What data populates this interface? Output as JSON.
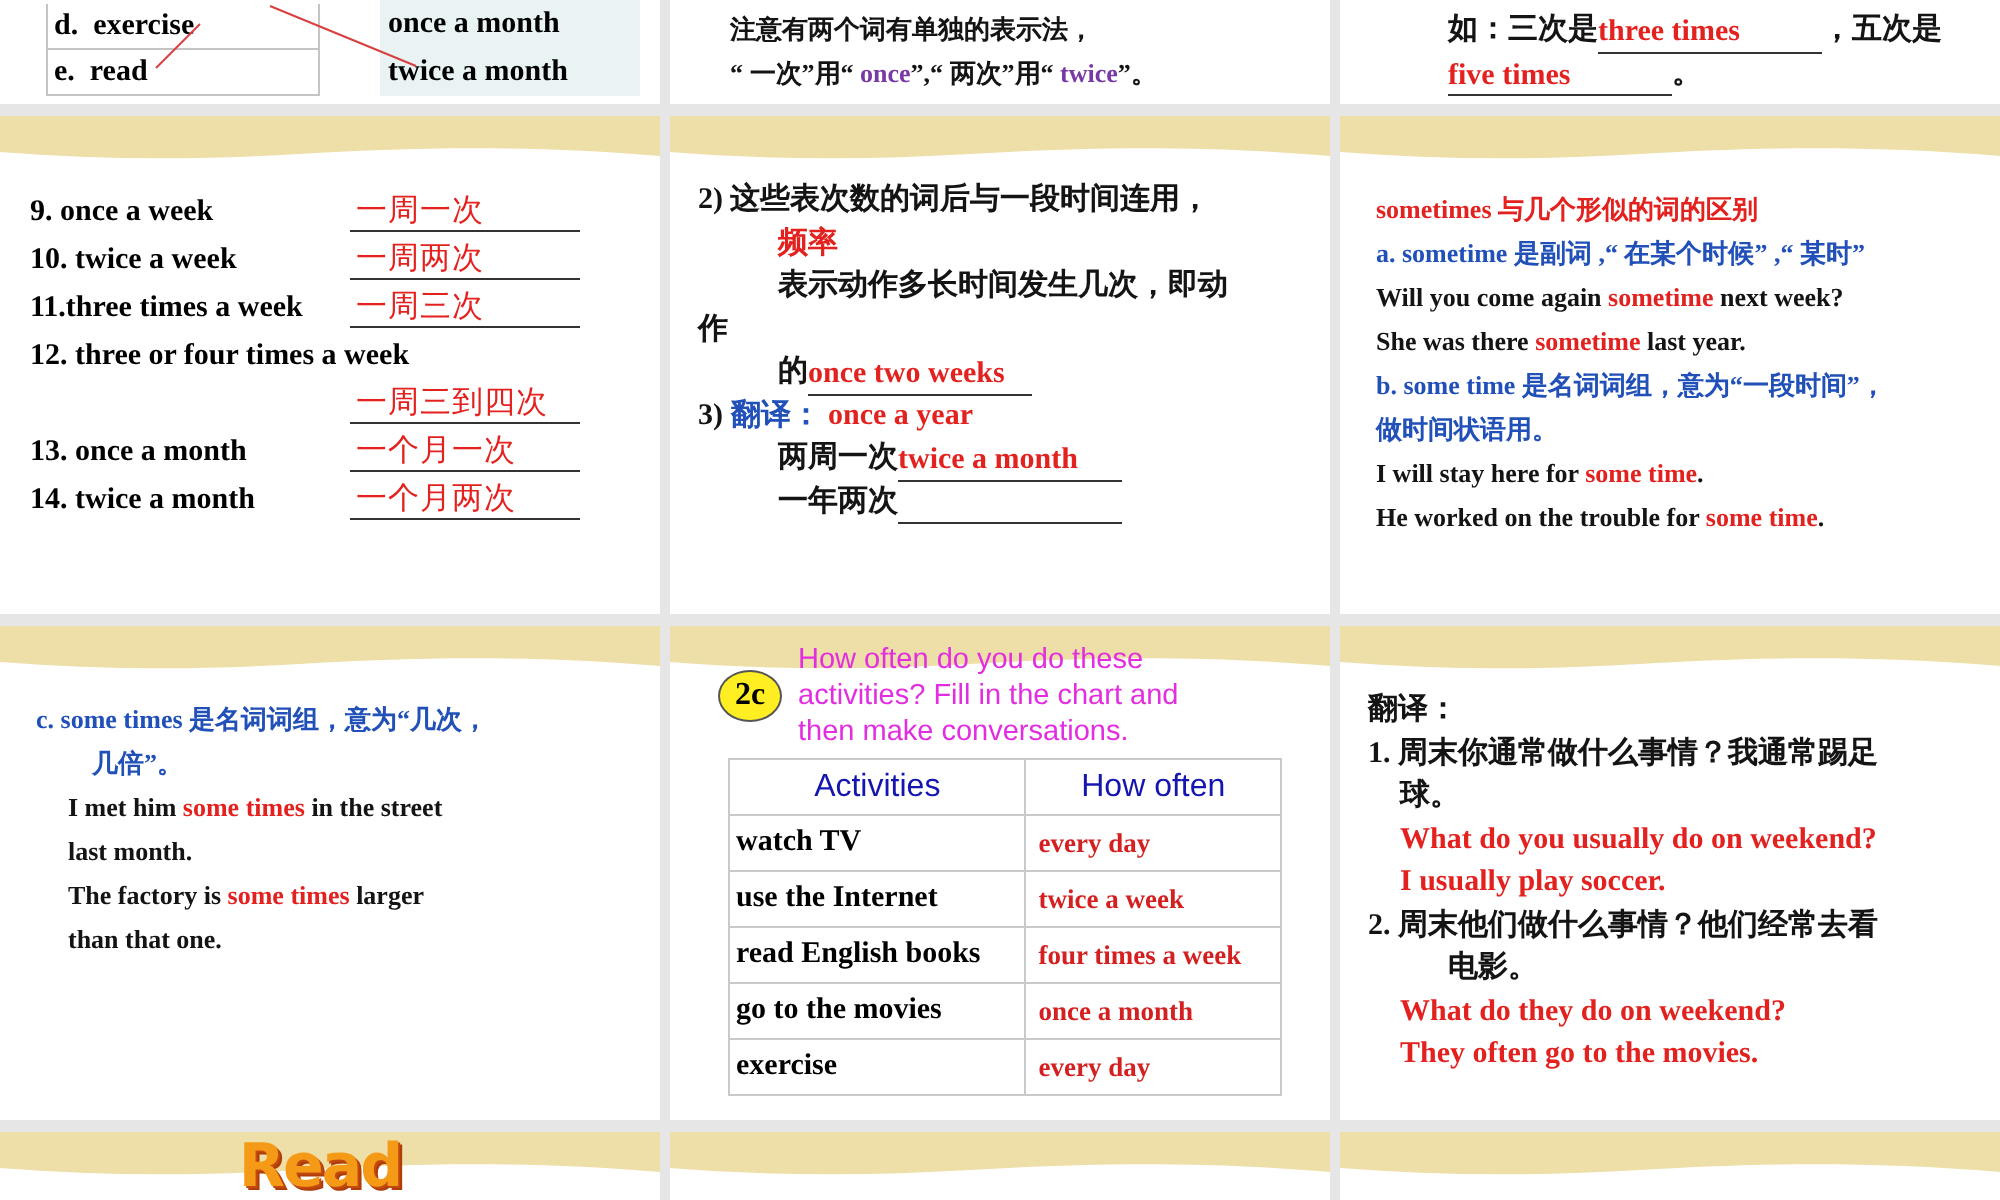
{
  "slides": [
    {
      "kind": "matching",
      "activities": [
        "d.  exercise",
        "e.  read"
      ],
      "options": [
        "once a month",
        "twice a month"
      ]
    },
    {
      "kind": "grammar",
      "lines": [
        {
          "kind": "note",
          "text": "注意有两个词有单独的表示法，"
        },
        {
          "kind": "note",
          "text": "“ 一次”用“ *once*”,“ 两次”用“ *twice*”。"
        }
      ]
    },
    {
      "kind": "exercise",
      "lines": [
        {
          "kind": "fill",
          "before": "如：三次是 ",
          "answer": "three times",
          "after": " ，五次是"
        },
        {
          "kind": "fill",
          "answer": "five times",
          "after": " 。"
        }
      ]
    },
    {
      "kind": "vocab",
      "items": [
        {
          "kind": "inline",
          "term": "9. once a week",
          "answer": "一周一次"
        },
        {
          "kind": "inline",
          "term": "10. twice a week",
          "answer": "一周两次"
        },
        {
          "kind": "inline",
          "term": "11.three times a week",
          "answer": "一周三次"
        },
        {
          "kind": "below",
          "term": "12. three or four times a week",
          "answer": "一周三到四次"
        },
        {
          "kind": "inline",
          "term": "13. once a month",
          "answer": "一个月一次"
        },
        {
          "kind": "inline",
          "term": "14. twice a month",
          "answer": "一个月两次"
        }
      ]
    },
    {
      "kind": "exercise",
      "lines": [
        {
          "kind": "plain",
          "text": "2)  这些表次数的词后与一段时间连用，"
        },
        {
          "kind": "mark",
          "text": "频率"
        },
        {
          "kind": "wrap",
          "text": "表示动作多长时间发生几次，即动"
        },
        {
          "kind": "plain",
          "text": "作"
        },
        {
          "kind": "fill",
          "before": "的 ",
          "answer": "once two weeks"
        },
        {
          "kind": "plain",
          "text": "3)  **翻译：**     *once a year*"
        },
        {
          "kind": "fill",
          "before": "两周一次  ",
          "answer": "twice a month"
        },
        {
          "kind": "fill",
          "before": "一年两次  "
        }
      ]
    },
    {
      "kind": "grammar",
      "lines": [
        {
          "kind": "heading",
          "text": "sometimes 与几个形似的词的区别"
        },
        {
          "kind": "topic",
          "text": "a. sometime 是副词 ,“ 在某个时候” ,“ 某时”"
        },
        {
          "kind": "plain",
          "text": "Will you come again *sometime* next week?"
        },
        {
          "kind": "plain",
          "text": " She was there *sometime* last year."
        },
        {
          "kind": "topic",
          "text": "b. some time 是名词词组，意为“一段时间”，"
        },
        {
          "kind": "topic",
          "text": "做时间状语用。"
        },
        {
          "kind": "plain",
          "text": "I will stay here for *some time*."
        },
        {
          "kind": "plain",
          "text": "He worked on the trouble for *some time*."
        }
      ]
    },
    {
      "kind": "grammar",
      "lines": [
        {
          "kind": "topic",
          "text": "c. some times 是名词词组，意为“几次，"
        },
        {
          "kind": "subtopic",
          "text": "几倍”。"
        },
        {
          "kind": "indent",
          "text": "I met him *some times* in the street"
        },
        {
          "kind": "indent",
          "text": "last month."
        },
        {
          "kind": "indent",
          "text": "The factory is *some times* larger"
        },
        {
          "kind": "indent",
          "text": "than that one."
        }
      ]
    },
    {
      "kind": "table",
      "badge": "2c",
      "prompt": "How often do you do these activities? Fill in the chart and then make conversations.",
      "columns": [
        "Activities",
        "How often"
      ],
      "rows": [
        [
          "watch TV",
          "every day"
        ],
        [
          "use the Internet",
          "twice a week"
        ],
        [
          "read English books",
          "four times a week"
        ],
        [
          "go to the movies",
          "once a month"
        ],
        [
          "exercise",
          "every day"
        ]
      ]
    },
    {
      "kind": "exercise",
      "lines": [
        {
          "kind": "plain",
          "text": "翻译："
        },
        {
          "kind": "plain",
          "text": "1.  周末你通常做什么事情？我通常踢足"
        },
        {
          "kind": "indent",
          "text": "球。"
        },
        {
          "kind": "answer",
          "text": "What do you usually do on weekend?"
        },
        {
          "kind": "answer",
          "text": " I usually play soccer."
        },
        {
          "kind": "plain",
          "text": "2.  周末他们做什么事情？他们经常去看"
        },
        {
          "kind": "wrap",
          "text": "电影。"
        },
        {
          "kind": "answer",
          "text": "What do they do on weekend?"
        },
        {
          "kind": "answer",
          "text": "They often go to the movies."
        }
      ]
    },
    {
      "kind": "wordart",
      "title": "Read"
    },
    {
      "kind": "blank"
    },
    {
      "kind": "blank"
    }
  ]
}
